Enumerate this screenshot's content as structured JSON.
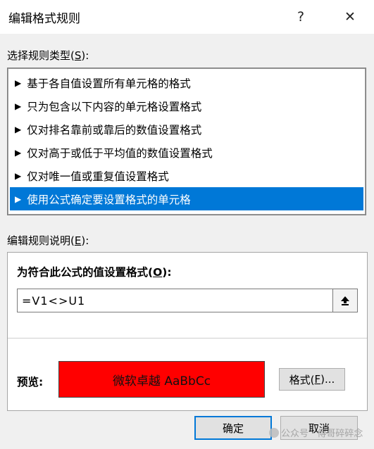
{
  "window": {
    "title": "编辑格式规则",
    "help_glyph": "?",
    "close_glyph": "✕"
  },
  "rule_type": {
    "label_prefix": "选择规则类型(",
    "label_key": "S",
    "label_suffix": "):",
    "items": [
      {
        "label": "基于各自值设置所有单元格的格式",
        "selected": false
      },
      {
        "label": "只为包含以下内容的单元格设置格式",
        "selected": false
      },
      {
        "label": "仅对排名靠前或靠后的数值设置格式",
        "selected": false
      },
      {
        "label": "仅对高于或低于平均值的数值设置格式",
        "selected": false
      },
      {
        "label": "仅对唯一值或重复值设置格式",
        "selected": false
      },
      {
        "label": "使用公式确定要设置格式的单元格",
        "selected": true
      }
    ],
    "arrow_glyph": "▶"
  },
  "description": {
    "label_prefix": "编辑规则说明(",
    "label_key": "E",
    "label_suffix": "):",
    "formula_label_prefix": "为符合此公式的值设置格式(",
    "formula_label_key": "O",
    "formula_label_suffix": "):",
    "formula_value": "=V1<>U1",
    "preview_label": "预览:",
    "preview_text": "微软卓越  AaBbCc",
    "preview_fill": "#ff0000",
    "format_button_prefix": "格式(",
    "format_button_key": "F",
    "format_button_suffix": ")..."
  },
  "footer": {
    "ok_label": "确定",
    "cancel_label": "取消"
  },
  "watermark": "公众号 · 傅哥碎碎念",
  "colors": {
    "selection": "#0078d7",
    "default_button_border": "#0078d7"
  }
}
